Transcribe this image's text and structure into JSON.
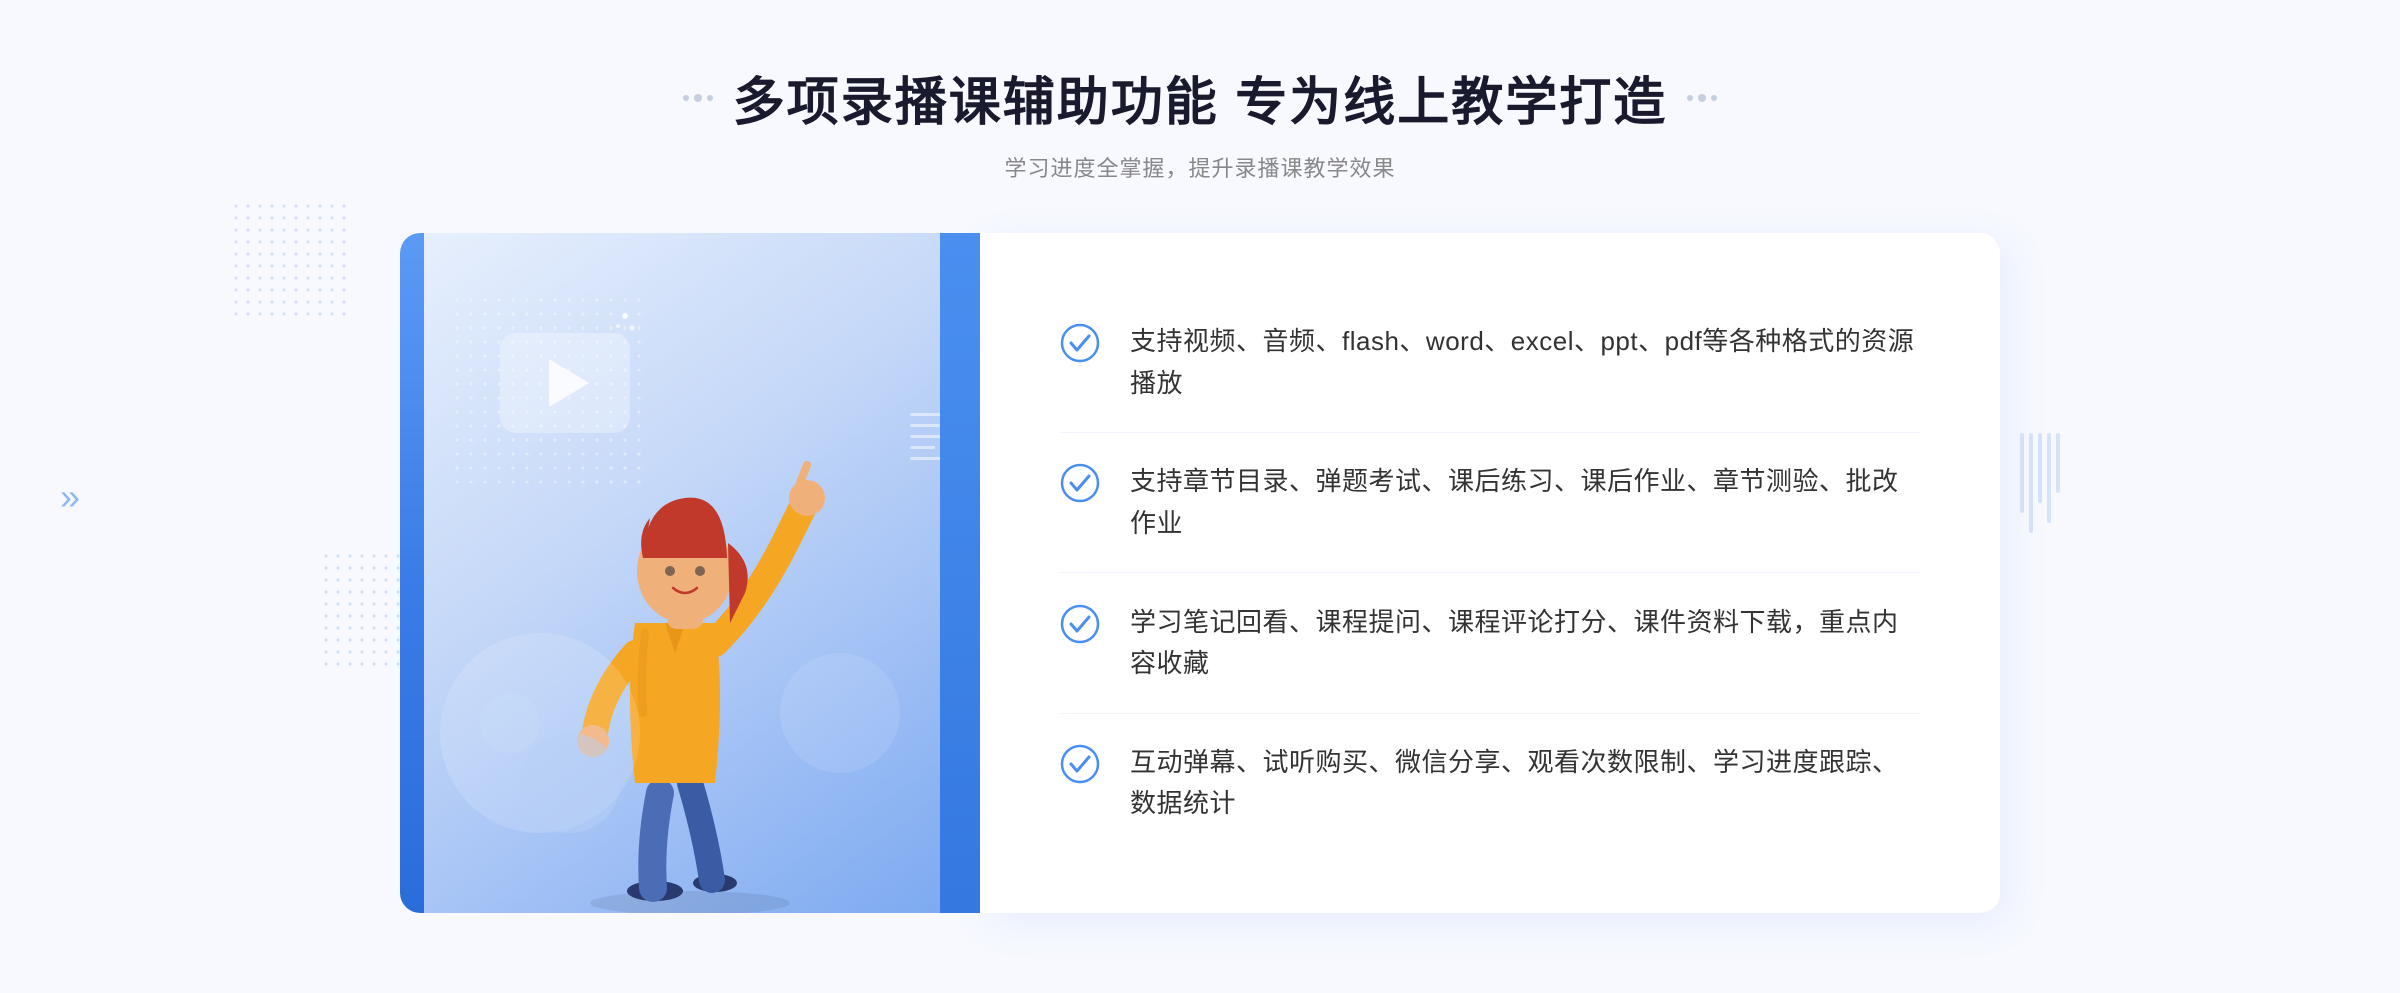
{
  "header": {
    "title": "多项录播课辅助功能 专为线上教学打造",
    "subtitle": "学习进度全掌握，提升录播课教学效果",
    "dots_left": [
      "·",
      "·"
    ],
    "dots_right": [
      "·",
      "·"
    ]
  },
  "features": [
    {
      "id": "feature-1",
      "text": "支持视频、音频、flash、word、excel、ppt、pdf等各种格式的资源播放"
    },
    {
      "id": "feature-2",
      "text": "支持章节目录、弹题考试、课后练习、课后作业、章节测验、批改作业"
    },
    {
      "id": "feature-3",
      "text": "学习笔记回看、课程提问、课程评论打分、课件资料下载，重点内容收藏"
    },
    {
      "id": "feature-4",
      "text": "互动弹幕、试听购买、微信分享、观看次数限制、学习进度跟踪、数据统计"
    }
  ],
  "colors": {
    "accent_blue": "#3478e0",
    "light_blue": "#7aadf0",
    "check_color": "#4a8ef0",
    "title_color": "#1a1a2e",
    "text_color": "#333333",
    "subtitle_color": "#888888"
  }
}
